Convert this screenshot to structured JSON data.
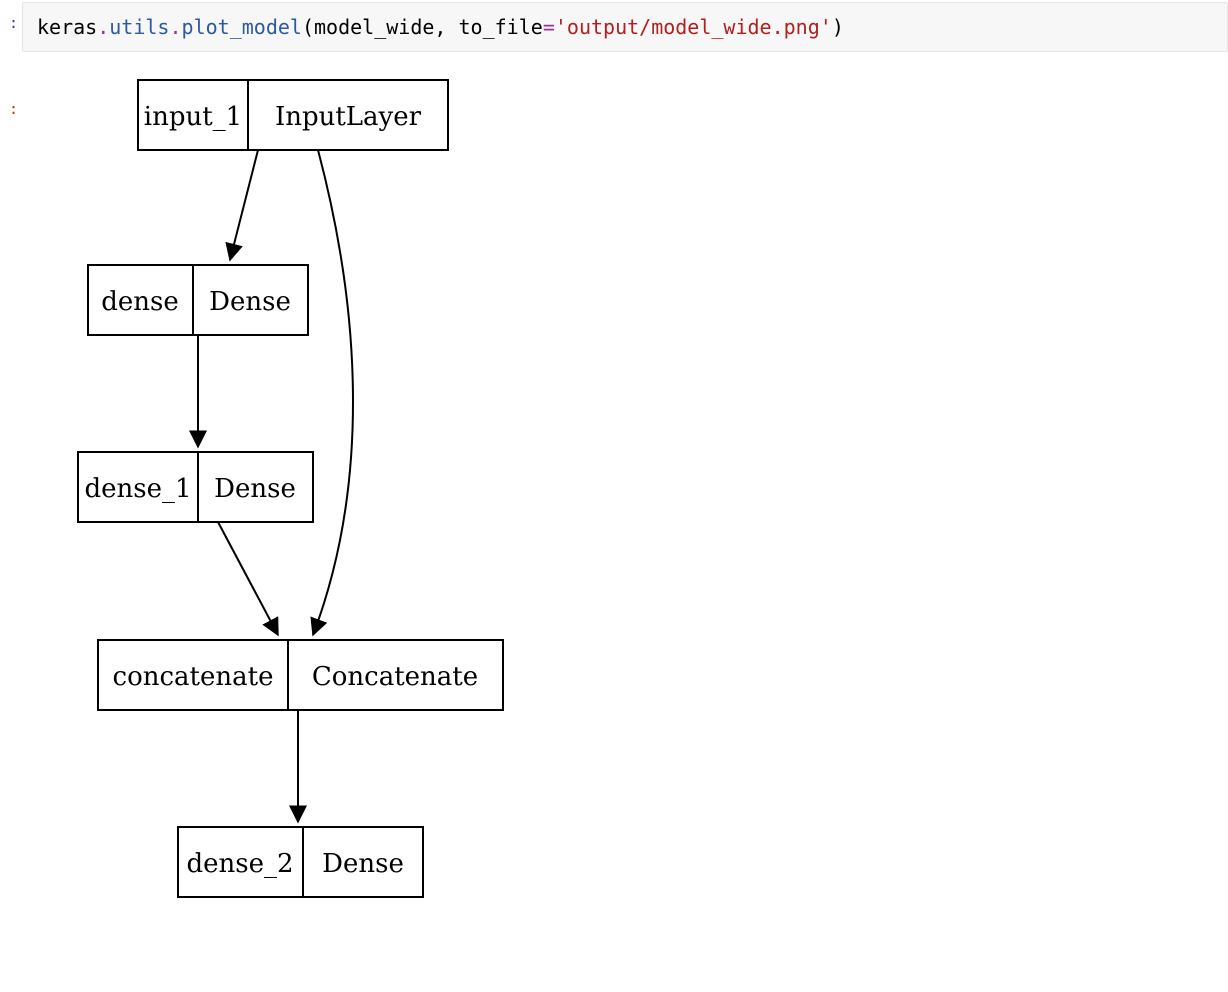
{
  "code": {
    "raw": "keras.utils.plot_model(model_wide, to_file='output/model_wide.png')",
    "tokens": {
      "keras": "keras",
      "dot1": ".",
      "utils": "utils",
      "dot2": ".",
      "fn": "plot_model",
      "open": "(",
      "arg1": "model_wide",
      "comma": ", ",
      "kw": "to_file",
      "eq": "=",
      "str": "'output/model_wide.png'",
      "close": ")"
    }
  },
  "prompt_in": ":",
  "prompt_out": ":",
  "diagram": {
    "nodes": [
      {
        "id": "input_1",
        "name": "input_1",
        "type": "InputLayer"
      },
      {
        "id": "dense",
        "name": "dense",
        "type": "Dense"
      },
      {
        "id": "dense_1",
        "name": "dense_1",
        "type": "Dense"
      },
      {
        "id": "concatenate",
        "name": "concatenate",
        "type": "Concatenate"
      },
      {
        "id": "dense_2",
        "name": "dense_2",
        "type": "Dense"
      }
    ],
    "edges": [
      {
        "from": "input_1",
        "to": "dense"
      },
      {
        "from": "dense",
        "to": "dense_1"
      },
      {
        "from": "dense_1",
        "to": "concatenate"
      },
      {
        "from": "input_1",
        "to": "concatenate"
      },
      {
        "from": "concatenate",
        "to": "dense_2"
      }
    ]
  }
}
